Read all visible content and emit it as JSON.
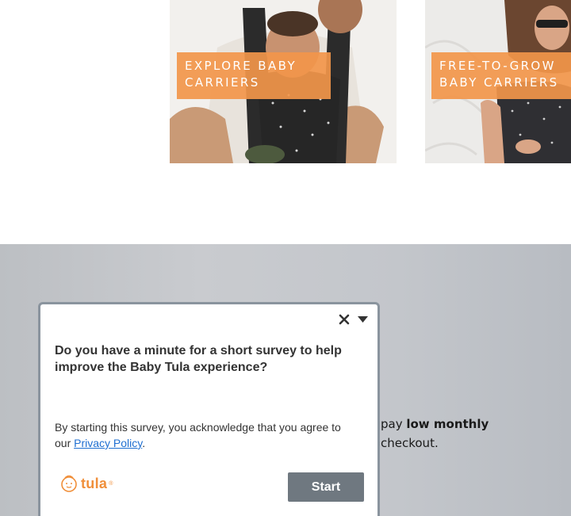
{
  "tiles": [
    {
      "label_line1": "EXPLORE BABY",
      "label_line2": "CARRIERS",
      "photo": "father-with-baby-in-carrier"
    },
    {
      "label_line1": "FREE-TO-GROW",
      "label_line2": "BABY CARRIERS",
      "photo": "mother-wearing-carrier"
    }
  ],
  "promo": {
    "line1_prefix": "pay ",
    "line1_bold": "low monthly",
    "line2": "checkout."
  },
  "survey": {
    "question": "Do you have a minute for a short survey to help improve the Baby Tula experience?",
    "consent_text": "By starting this survey, you acknowledge that you agree to our ",
    "privacy_link": "Privacy Policy",
    "consent_end": ".",
    "logo_text": "tula",
    "logo_reg": "®",
    "start_label": "Start"
  },
  "colors": {
    "accent_orange": "#f2964a",
    "start_button": "#6f7880",
    "link": "#1f6fd1",
    "dialog_border": "#8a949e"
  },
  "icons": {
    "close": "close-icon",
    "minimize": "caret-down-icon",
    "logo": "tula-baby-logo-icon"
  }
}
